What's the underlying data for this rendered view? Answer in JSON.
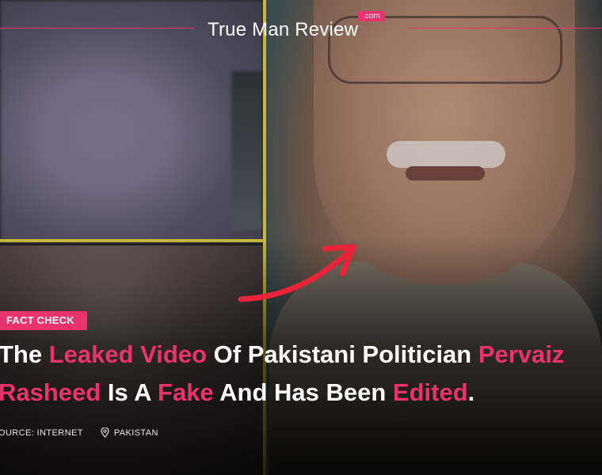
{
  "brand": {
    "name": "True Man Review",
    "tld": ".com"
  },
  "article": {
    "category": "FACT CHECK",
    "headline_parts": [
      {
        "text": "The ",
        "highlight": false
      },
      {
        "text": "Leaked Video",
        "highlight": true
      },
      {
        "text": " Of Pakistani Politician ",
        "highlight": false
      },
      {
        "text": "Pervaiz",
        "highlight": true
      },
      {
        "text": "Rasheed",
        "highlight": true
      },
      {
        "text": " Is A ",
        "highlight": false
      },
      {
        "text": "Fake",
        "highlight": true
      },
      {
        "text": " And Has Been ",
        "highlight": false
      },
      {
        "text": "Edited",
        "highlight": true
      },
      {
        "text": ".",
        "highlight": false
      }
    ],
    "source": "OURCE: INTERNET",
    "location": "PAKISTAN"
  },
  "colors": {
    "accent": "#e8336e",
    "frame": "#c8b83a",
    "text": "#ffffff"
  },
  "icons": {
    "location": "location-pin-icon",
    "arrow": "red-arrow"
  }
}
